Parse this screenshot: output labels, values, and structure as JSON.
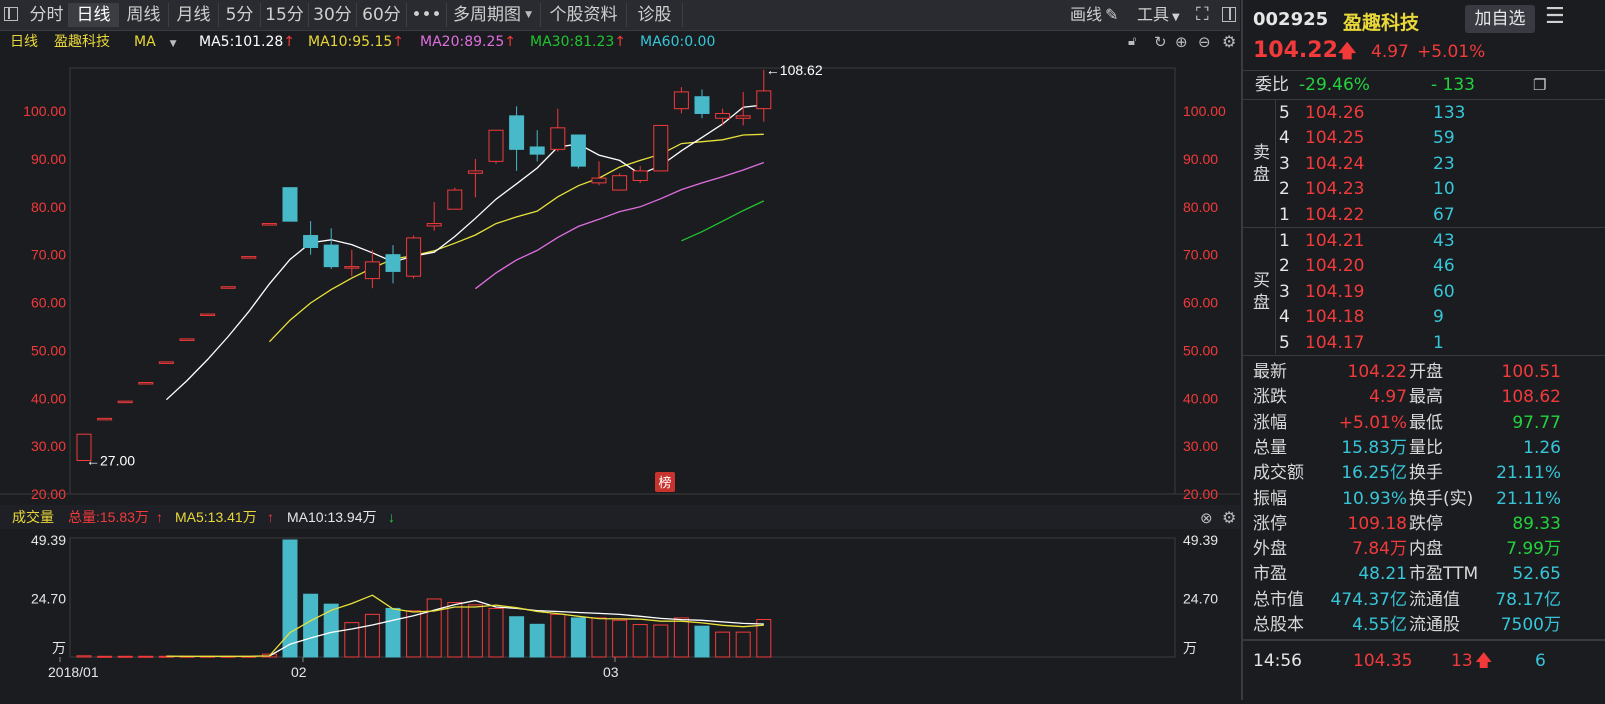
{
  "toolbar": {
    "tabs": [
      "分时",
      "日线",
      "周线",
      "月线",
      "5分",
      "15分",
      "30分",
      "60分",
      "•••",
      "多周期图",
      "个股资料",
      "诊股"
    ],
    "active_tab": "日线",
    "draw_label": "画线",
    "tools_label": "工具"
  },
  "ma_bar": {
    "period": "日线",
    "name": "盈趣科技",
    "ma_label": "MA",
    "ma5": "MA5:101.28",
    "ma10": "MA10:95.15",
    "ma20": "MA20:89.25",
    "ma30": "MA30:81.23",
    "ma60": "MA60:0.00"
  },
  "vol_bar": {
    "title": "成交量",
    "total": "总量:15.83万",
    "ma5": "MA5:13.41万",
    "ma10": "MA10:13.94万"
  },
  "colors": {
    "up": "#f23a3a",
    "down": "#48b9c9",
    "ma5": "#ffffff",
    "ma10": "#e8e13a",
    "ma20": "#e06ee0",
    "ma30": "#21c42f",
    "ma60": "#36c6d8"
  },
  "chart_data": {
    "type": "candlestick",
    "price_axis": {
      "ylim": [
        20,
        109
      ],
      "ticks": [
        "100.00",
        "90.00",
        "80.00",
        "70.00",
        "60.00",
        "50.00",
        "40.00",
        "30.00",
        "20.00"
      ]
    },
    "annotations": {
      "high_label": "108.62",
      "low_label": "27.00",
      "badge": "榜"
    },
    "x_labels": [
      "2018/01",
      "02",
      "03"
    ],
    "candles": [
      {
        "o": 27.0,
        "h": 32.5,
        "l": 27.0,
        "c": 32.5,
        "v": 0.5
      },
      {
        "o": 35.8,
        "h": 35.8,
        "l": 35.8,
        "c": 35.8,
        "v": 0.3
      },
      {
        "o": 39.4,
        "h": 39.4,
        "l": 39.4,
        "c": 39.4,
        "v": 0.3
      },
      {
        "o": 43.3,
        "h": 43.3,
        "l": 43.3,
        "c": 43.3,
        "v": 0.3
      },
      {
        "o": 47.6,
        "h": 47.6,
        "l": 47.6,
        "c": 47.6,
        "v": 0.3
      },
      {
        "o": 52.4,
        "h": 52.4,
        "l": 52.4,
        "c": 52.4,
        "v": 0.3
      },
      {
        "o": 57.6,
        "h": 57.6,
        "l": 57.6,
        "c": 57.6,
        "v": 0.3
      },
      {
        "o": 63.3,
        "h": 63.3,
        "l": 63.3,
        "c": 63.3,
        "v": 0.3
      },
      {
        "o": 69.6,
        "h": 69.6,
        "l": 69.6,
        "c": 69.6,
        "v": 0.3
      },
      {
        "o": 76.5,
        "h": 76.5,
        "l": 76.5,
        "c": 76.5,
        "v": 1.2
      },
      {
        "o": 84.0,
        "h": 84.0,
        "l": 77.0,
        "c": 77.0,
        "v": 49.39
      },
      {
        "o": 74.0,
        "h": 77.0,
        "l": 70.0,
        "c": 71.5,
        "v": 26.5
      },
      {
        "o": 72.0,
        "h": 75.5,
        "l": 67.0,
        "c": 67.5,
        "v": 22.3
      },
      {
        "o": 67.5,
        "h": 71.0,
        "l": 65.5,
        "c": 67.5,
        "v": 14.5
      },
      {
        "o": 65.0,
        "h": 71.0,
        "l": 63.0,
        "c": 68.5,
        "v": 18.0
      },
      {
        "o": 70.0,
        "h": 72.0,
        "l": 64.0,
        "c": 66.5,
        "v": 20.5
      },
      {
        "o": 65.5,
        "h": 74.0,
        "l": 65.0,
        "c": 73.5,
        "v": 19.5
      },
      {
        "o": 76.0,
        "h": 81.0,
        "l": 75.0,
        "c": 76.5,
        "v": 24.5
      },
      {
        "o": 79.5,
        "h": 84.0,
        "l": 79.5,
        "c": 83.5,
        "v": 23.0
      },
      {
        "o": 87.0,
        "h": 90.0,
        "l": 82.0,
        "c": 87.5,
        "v": 22.0
      },
      {
        "o": 89.5,
        "h": 96.0,
        "l": 89.0,
        "c": 96.0,
        "v": 20.5
      },
      {
        "o": 99.0,
        "h": 101.0,
        "l": 87.5,
        "c": 92.0,
        "v": 17.0
      },
      {
        "o": 92.5,
        "h": 96.0,
        "l": 89.5,
        "c": 91.0,
        "v": 13.8
      },
      {
        "o": 92.0,
        "h": 100.5,
        "l": 91.5,
        "c": 96.5,
        "v": 18.0
      },
      {
        "o": 95.0,
        "h": 95.0,
        "l": 88.0,
        "c": 88.5,
        "v": 16.5
      },
      {
        "o": 85.0,
        "h": 89.5,
        "l": 84.5,
        "c": 86.0,
        "v": 16.5
      },
      {
        "o": 83.5,
        "h": 87.0,
        "l": 83.5,
        "c": 86.5,
        "v": 15.5
      },
      {
        "o": 85.5,
        "h": 88.5,
        "l": 85.0,
        "c": 87.5,
        "v": 13.7
      },
      {
        "o": 87.5,
        "h": 97.0,
        "l": 87.5,
        "c": 97.0,
        "v": 13.5
      },
      {
        "o": 100.5,
        "h": 105.0,
        "l": 99.5,
        "c": 104.0,
        "v": 16.5
      },
      {
        "o": 103.0,
        "h": 104.5,
        "l": 98.5,
        "c": 99.5,
        "v": 13.0
      },
      {
        "o": 98.5,
        "h": 100.5,
        "l": 97.0,
        "c": 99.5,
        "v": 10.5
      },
      {
        "o": 98.5,
        "h": 104.0,
        "l": 97.0,
        "c": 99.0,
        "v": 10.5
      },
      {
        "o": 100.51,
        "h": 108.62,
        "l": 97.77,
        "c": 104.22,
        "v": 15.83
      }
    ],
    "ma5": [
      null,
      null,
      null,
      null,
      39.7,
      43.7,
      48.1,
      52.9,
      58.1,
      63.9,
      69.0,
      72.5,
      73.1,
      72.1,
      70.4,
      68.5,
      69.7,
      70.5,
      73.8,
      77.6,
      81.6,
      84.8,
      88.1,
      92.5,
      93.1,
      90.8,
      89.7,
      86.8,
      88.6,
      91.7,
      94.5,
      97.3,
      100.8,
      101.28
    ],
    "ma10": [
      null,
      null,
      null,
      null,
      null,
      null,
      null,
      null,
      null,
      51.8,
      56.3,
      59.9,
      62.7,
      65.1,
      67.2,
      69.1,
      69.8,
      70.8,
      72.4,
      74.1,
      76.5,
      77.9,
      79.1,
      82.1,
      84.4,
      86.0,
      88.3,
      89.7,
      91.0,
      93.2,
      93.6,
      94.0,
      95.0,
      95.15
    ],
    "ma20": [
      null,
      null,
      null,
      null,
      null,
      null,
      null,
      null,
      null,
      null,
      null,
      null,
      null,
      null,
      null,
      null,
      null,
      null,
      null,
      62.9,
      66.2,
      68.9,
      70.9,
      73.6,
      75.9,
      77.4,
      79.0,
      80.0,
      81.7,
      83.6,
      85.0,
      86.3,
      87.7,
      89.25
    ],
    "ma30": [
      null,
      null,
      null,
      null,
      null,
      null,
      null,
      null,
      null,
      null,
      null,
      null,
      null,
      null,
      null,
      null,
      null,
      null,
      null,
      null,
      null,
      null,
      null,
      null,
      null,
      null,
      null,
      null,
      null,
      72.9,
      74.8,
      77.0,
      79.2,
      81.23
    ],
    "volume_axis": {
      "ylim": [
        0,
        49.39
      ],
      "ticks": [
        "49.39",
        "24.70"
      ],
      "unit": "万"
    },
    "vol_ma5": [
      null,
      null,
      null,
      null,
      0.34,
      0.3,
      0.3,
      0.3,
      0.3,
      0.48,
      10.3,
      15.3,
      19.7,
      22.6,
      26.1,
      20.3,
      19.0,
      19.4,
      21.1,
      21.1,
      21.9,
      20.8,
      19.2,
      18.3,
      17.2,
      16.2,
      16.1,
      16.0,
      15.1,
      15.1,
      14.4,
      13.4,
      12.8,
      13.41
    ],
    "vol_ma10": [
      null,
      null,
      null,
      null,
      null,
      null,
      null,
      null,
      null,
      0.42,
      5.4,
      8.0,
      10.4,
      11.8,
      13.5,
      15.5,
      17.4,
      19.8,
      22.1,
      23.8,
      21.1,
      20.5,
      19.6,
      19.2,
      18.8,
      18.4,
      18.0,
      17.2,
      16.3,
      15.8,
      15.5,
      14.8,
      14.2,
      13.94
    ]
  },
  "quote": {
    "code": "002925",
    "name": "盈趣科技",
    "add_button": "加自选",
    "price": "104.22",
    "change": "4.97",
    "pct": "+5.01%",
    "webi_label": "委比",
    "webi_pct": "-29.46%",
    "webi_diff": "- 133",
    "sell_label": [
      "卖",
      "盘"
    ],
    "buy_label": [
      "买",
      "盘"
    ],
    "asks": [
      {
        "lvl": "5",
        "price": "104.26",
        "vol": "133"
      },
      {
        "lvl": "4",
        "price": "104.25",
        "vol": "59"
      },
      {
        "lvl": "3",
        "price": "104.24",
        "vol": "23"
      },
      {
        "lvl": "2",
        "price": "104.23",
        "vol": "10"
      },
      {
        "lvl": "1",
        "price": "104.22",
        "vol": "67"
      }
    ],
    "bids": [
      {
        "lvl": "1",
        "price": "104.21",
        "vol": "43"
      },
      {
        "lvl": "2",
        "price": "104.20",
        "vol": "46"
      },
      {
        "lvl": "3",
        "price": "104.19",
        "vol": "60"
      },
      {
        "lvl": "4",
        "price": "104.18",
        "vol": "9"
      },
      {
        "lvl": "5",
        "price": "104.17",
        "vol": "1"
      }
    ],
    "stats": [
      {
        "l1": "最新",
        "v1": "104.22",
        "c1": "red",
        "l2": "开盘",
        "v2": "100.51",
        "c2": "red"
      },
      {
        "l1": "涨跌",
        "v1": "4.97",
        "c1": "red",
        "l2": "最高",
        "v2": "108.62",
        "c2": "red"
      },
      {
        "l1": "涨幅",
        "v1": "+5.01%",
        "c1": "red",
        "l2": "最低",
        "v2": "97.77",
        "c2": "green"
      },
      {
        "l1": "总量",
        "v1": "15.83万",
        "c1": "cyan",
        "l2": "量比",
        "v2": "1.26",
        "c2": "cyan"
      },
      {
        "l1": "成交额",
        "v1": "16.25亿",
        "c1": "cyan",
        "l2": "换手",
        "v2": "21.11%",
        "c2": "cyan"
      },
      {
        "l1": "振幅",
        "v1": "10.93%",
        "c1": "cyan",
        "l2": "换手(实)",
        "v2": "21.11%",
        "c2": "cyan"
      },
      {
        "l1": "涨停",
        "v1": "109.18",
        "c1": "red",
        "l2": "跌停",
        "v2": "89.33",
        "c2": "green"
      },
      {
        "l1": "外盘",
        "v1": "7.84万",
        "c1": "red",
        "l2": "内盘",
        "v2": "7.99万",
        "c2": "green"
      },
      {
        "l1": "市盈",
        "v1": "48.21",
        "c1": "cyan",
        "l2": "市盈TTM",
        "v2": "52.65",
        "c2": "cyan"
      },
      {
        "l1": "总市值",
        "v1": "474.37亿",
        "c1": "cyan",
        "l2": "流通值",
        "v2": "78.17亿",
        "c2": "cyan"
      },
      {
        "l1": "总股本",
        "v1": "4.55亿",
        "c1": "cyan",
        "l2": "流通股",
        "v2": "7500万",
        "c2": "cyan"
      }
    ],
    "tick": {
      "time": "14:56",
      "price": "104.35",
      "vol": "13",
      "num": "6"
    }
  }
}
